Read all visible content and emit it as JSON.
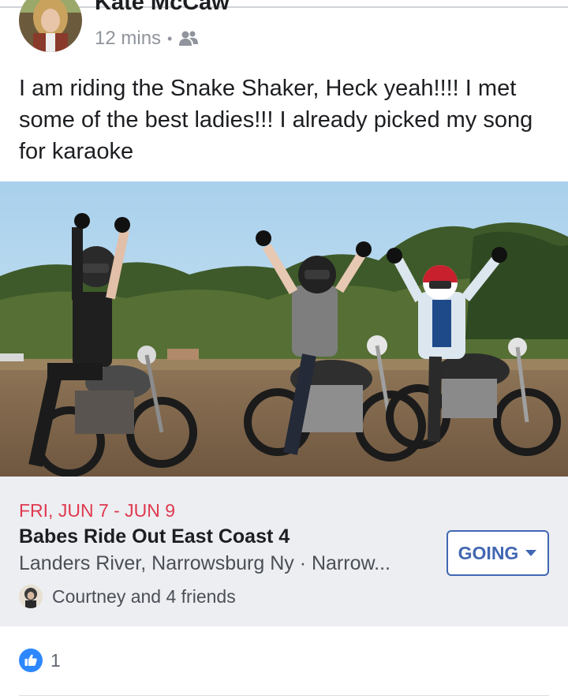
{
  "post": {
    "author": "Kate McCaw",
    "timestamp": "12 mins",
    "separator": "•",
    "audience_icon": "friends-icon",
    "text": "I am riding the Snake Shaker, Heck yeah!!!! I met some of the best ladies!!! I already picked my song for karaoke"
  },
  "event": {
    "date": "FRI, JUN 7 - JUN 9",
    "name": "Babes Ride Out East Coast 4",
    "location": "Landers River, Narrowsburg Ny · Narrow...",
    "going_label": "GOING",
    "friends_text": "Courtney and 4 friends"
  },
  "reactions": {
    "like_count": "1"
  },
  "colors": {
    "accent": "#4267b2",
    "date_red": "#e0394f",
    "card_bg": "#eceef2",
    "like_blue": "#2d88ff"
  }
}
